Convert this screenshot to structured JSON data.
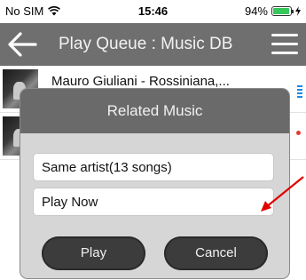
{
  "status_bar": {
    "carrier": "No SIM",
    "time": "15:46",
    "battery_percent": "94%",
    "battery_level": 0.94
  },
  "nav": {
    "title": "Play Queue : Music DB"
  },
  "list": {
    "items": [
      {
        "title": "Mauro Giuliani - Rossiniana,..."
      },
      {
        "title": ""
      }
    ]
  },
  "dialog": {
    "title": "Related Music",
    "options": [
      {
        "label": "Same artist(13 songs)"
      },
      {
        "label": "Play Now"
      }
    ],
    "play_label": "Play",
    "cancel_label": "Cancel"
  },
  "colors": {
    "nav_bg": "#6f6f6f",
    "dialog_header_bg": "#6a6a6a",
    "button_bg": "#3c3c3c",
    "battery_green": "#35c759",
    "arrow_red": "#e00000"
  }
}
